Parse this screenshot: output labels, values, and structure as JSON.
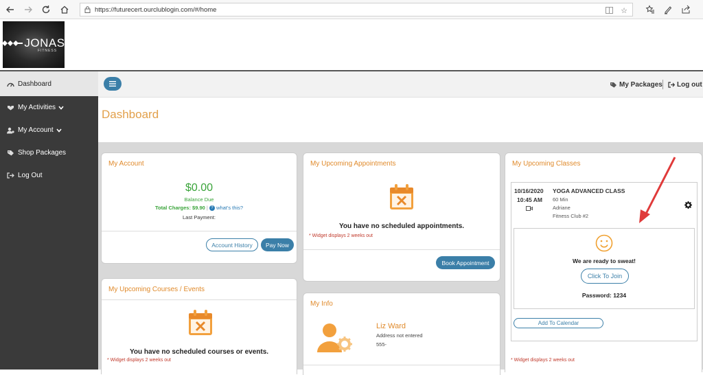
{
  "browser": {
    "url": "https://futurecert.ourclublogin.com/#/home"
  },
  "logo": {
    "word": "JONAS",
    "sub": "FITNESS"
  },
  "sidebar": {
    "items": [
      {
        "label": "Dashboard",
        "icon": "tachometer-icon"
      },
      {
        "label": "My Activities",
        "icon": "activities-icon",
        "chevron": "❯"
      },
      {
        "label": "My Account",
        "icon": "account-icon",
        "chevron": "❯"
      },
      {
        "label": "Shop Packages",
        "icon": "tag-icon"
      },
      {
        "label": "Log Out",
        "icon": "logout-icon"
      }
    ]
  },
  "topbar": {
    "packages_label": "My Packages",
    "logout_label": "Log out"
  },
  "page_title": "Dashboard",
  "my_account": {
    "title": "My Account",
    "amount": "$0.00",
    "balance_label": "Balance Due",
    "total_label": "Total Charges: $9.90",
    "sep": "|",
    "whats_this": "what's this?",
    "last_payment": "Last Payment:",
    "history_button": "Account History",
    "pay_button": "Pay Now"
  },
  "appointments": {
    "title": "My Upcoming Appointments",
    "empty": "You have no scheduled appointments.",
    "note": "* Widget displays 2 weeks out",
    "book_button": "Book Appointment"
  },
  "courses": {
    "title": "My Upcoming Courses / Events",
    "empty": "You have no scheduled courses or events.",
    "note": "* Widget displays 2 weeks out"
  },
  "info": {
    "title": "My Info",
    "name": "Liz Ward",
    "address": "Address not entered",
    "phone": "555-"
  },
  "classes": {
    "title": "My Upcoming Classes",
    "date": "10/16/2020",
    "time": "10:45 AM",
    "class_name": "YOGA ADVANCED CLASS",
    "duration": "60 Min",
    "instructor": "Adriane",
    "location": "Fitness Club #2",
    "ready": "We are ready to sweat!",
    "join_button": "Click To Join",
    "password": "Password: 1234",
    "calendar_button": "Add To Calendar",
    "note": "* Widget displays 2 weeks out"
  },
  "colors": {
    "accent": "#e08a2b",
    "primary": "#3b7fa8",
    "green": "#3aa43a",
    "arrow": "#e03a3a"
  }
}
